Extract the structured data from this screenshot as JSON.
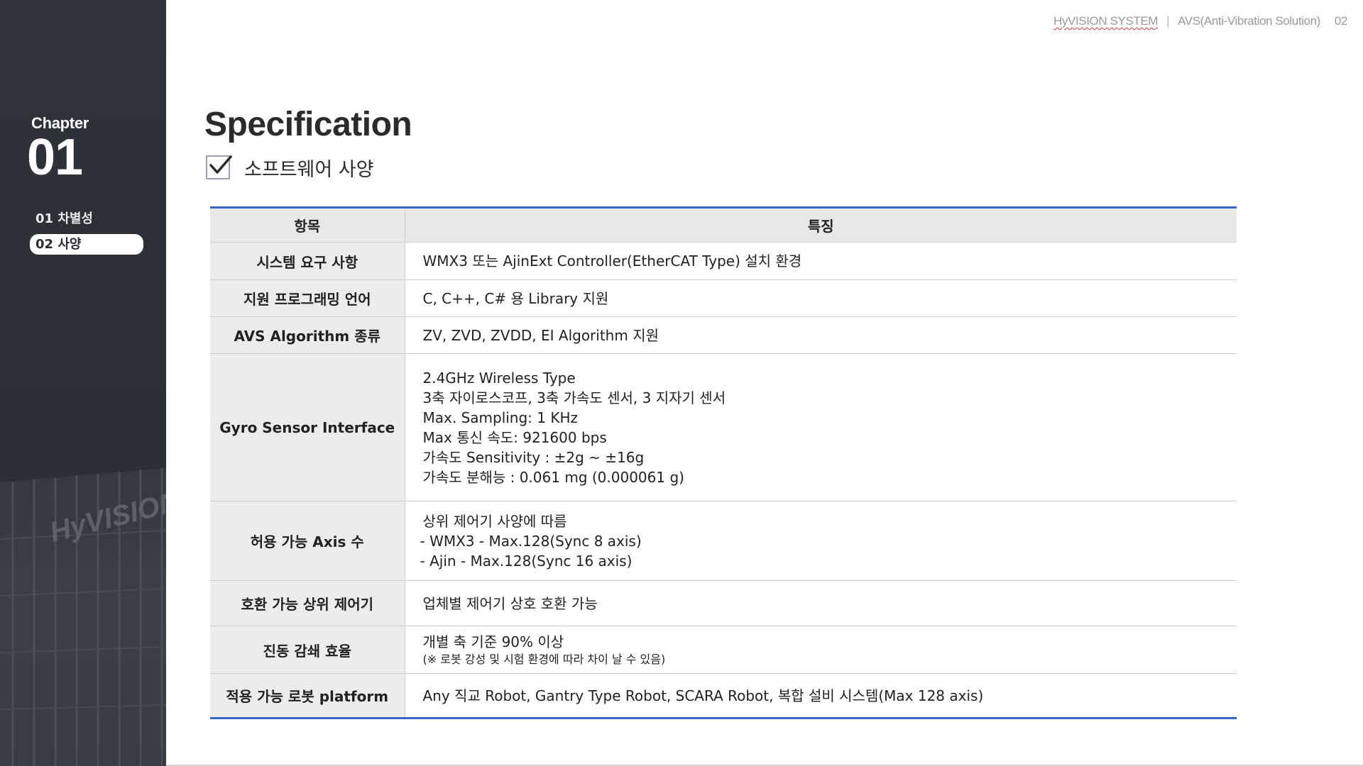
{
  "header": {
    "brand": "HyVISION SYSTEM",
    "product": "AVS(Anti-Vibration Solution)",
    "page_number": "02"
  },
  "sidebar": {
    "chapter_label": "Chapter",
    "chapter_number": "01",
    "items": [
      {
        "label": "01 차별성"
      },
      {
        "label": "02 사양"
      }
    ]
  },
  "main": {
    "title": "Specification",
    "subtitle": "소프트웨어 사양",
    "table": {
      "headers": [
        "항목",
        "특징"
      ],
      "rows": [
        {
          "label": "시스템 요구 사항",
          "lines": [
            "WMX3 또는 AjinExt Controller(EtherCAT Type) 설치 환경"
          ]
        },
        {
          "label": "지원 프로그래밍 언어",
          "lines": [
            "C, C++, C# 용 Library 지원"
          ]
        },
        {
          "label": "AVS Algorithm 종류",
          "lines": [
            "ZV, ZVD, ZVDD, EI Algorithm 지원"
          ]
        },
        {
          "label": "Gyro Sensor Interface",
          "lines": [
            "2.4GHz Wireless Type",
            "3축 자이로스코프, 3축 가속도 센서, 3 지자기 센서",
            "Max. Sampling: 1 KHz",
            "Max 통신 속도: 921600 bps",
            "가속도 Sensitivity : ±2g ~ ±16g",
            "가속도 분해능 : 0.061 mg (0.000061 g)"
          ]
        },
        {
          "label": "허용 가능 Axis 수",
          "lines": [
            "상위 제어기 사양에 따름",
            "- WMX3 - Max.128(Sync 8 axis)",
            "- Ajin - Max.128(Sync 16 axis)"
          ]
        },
        {
          "label": "호환 가능 상위 제어기",
          "lines": [
            "업체별 제어기 상호 호환 가능"
          ]
        },
        {
          "label": "진동 감쇄 효율",
          "lines": [
            "개별 축 기준 90% 이상"
          ],
          "note": "(※ 로봇 강성 및 시험 환경에 따라 차이 날 수 있음)"
        },
        {
          "label": "적용 가능 로봇 platform",
          "lines": [
            "Any 직교 Robot, Gantry Type Robot, SCARA Robot, 복합 설비 시스템(Max 128 axis)"
          ]
        }
      ]
    }
  },
  "icons": {
    "check": "checkbox-checked-icon",
    "building": "building-photo"
  },
  "colors": {
    "sidebar_bg": "#2f333a",
    "table_rule": "#3b64c8",
    "header_text": "#9a9a9a"
  }
}
